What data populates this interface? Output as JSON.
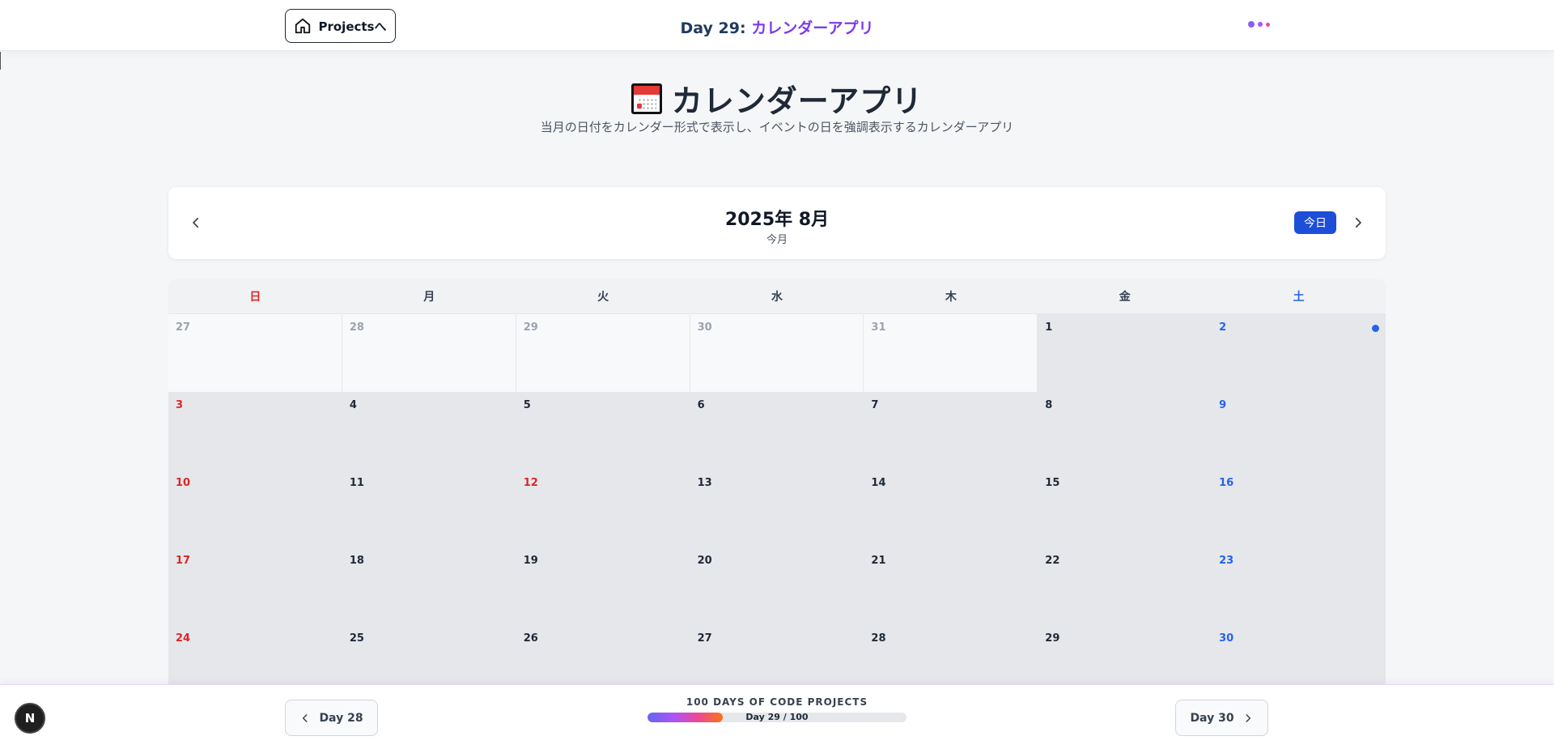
{
  "header": {
    "home_label": "Projectsへ",
    "title_day": "Day 29:",
    "title_app": "カレンダーアプリ"
  },
  "page": {
    "title": "カレンダーアプリ",
    "subtitle": "当月の日付をカレンダー形式で表示し、イベントの日を強調表示するカレンダーアプリ"
  },
  "calendar_nav": {
    "month_label": "2025年 8月",
    "month_sub": "今月",
    "today_label": "今日"
  },
  "calendar": {
    "weekdays": [
      "日",
      "月",
      "火",
      "水",
      "木",
      "金",
      "土"
    ],
    "days": [
      {
        "n": "27",
        "t": "other"
      },
      {
        "n": "28",
        "t": "other"
      },
      {
        "n": "29",
        "t": "other"
      },
      {
        "n": "30",
        "t": "other"
      },
      {
        "n": "31",
        "t": "other"
      },
      {
        "n": "1",
        "t": ""
      },
      {
        "n": "2",
        "t": "blue",
        "event": true
      },
      {
        "n": "3",
        "t": "red"
      },
      {
        "n": "4",
        "t": ""
      },
      {
        "n": "5",
        "t": ""
      },
      {
        "n": "6",
        "t": ""
      },
      {
        "n": "7",
        "t": ""
      },
      {
        "n": "8",
        "t": ""
      },
      {
        "n": "9",
        "t": "blue"
      },
      {
        "n": "10",
        "t": "red"
      },
      {
        "n": "11",
        "t": ""
      },
      {
        "n": "12",
        "t": "red"
      },
      {
        "n": "13",
        "t": ""
      },
      {
        "n": "14",
        "t": ""
      },
      {
        "n": "15",
        "t": ""
      },
      {
        "n": "16",
        "t": "blue"
      },
      {
        "n": "17",
        "t": "red"
      },
      {
        "n": "18",
        "t": ""
      },
      {
        "n": "19",
        "t": ""
      },
      {
        "n": "20",
        "t": ""
      },
      {
        "n": "21",
        "t": ""
      },
      {
        "n": "22",
        "t": ""
      },
      {
        "n": "23",
        "t": "blue"
      },
      {
        "n": "24",
        "t": "red"
      },
      {
        "n": "25",
        "t": ""
      },
      {
        "n": "26",
        "t": ""
      },
      {
        "n": "27",
        "t": ""
      },
      {
        "n": "28",
        "t": ""
      },
      {
        "n": "29",
        "t": ""
      },
      {
        "n": "30",
        "t": "blue"
      }
    ]
  },
  "footer": {
    "prev_label": "Day 28",
    "next_label": "Day 30",
    "progress_title": "100 DAYS OF CODE PROJECTS",
    "progress_text": "Day 29 / 100",
    "progress_value": 0.29,
    "logo_letter": "N"
  },
  "colors": {
    "accent_blue": "#1d4ed8",
    "sunday_red": "#dc2626",
    "saturday_blue": "#2563eb",
    "title_purple": "#7c3aed"
  },
  "icons": [
    "home-icon",
    "chevron-left-icon",
    "chevron-right-icon",
    "calendar-icon",
    "event-dot-icon"
  ]
}
